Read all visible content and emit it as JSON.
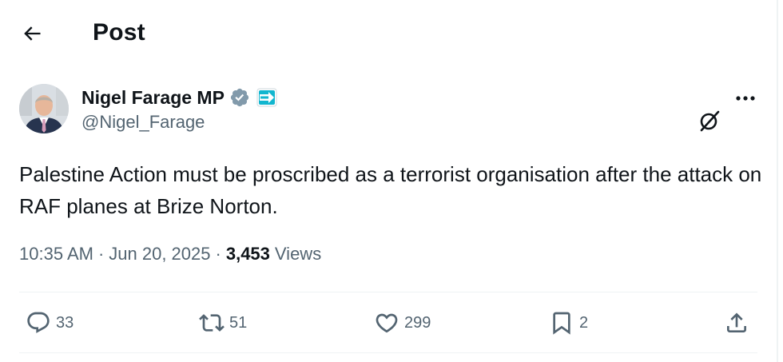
{
  "header": {
    "title": "Post",
    "back_icon": "arrow-left-icon"
  },
  "author": {
    "display_name": "Nigel Farage MP",
    "handle": "@Nigel_Farage",
    "verified_icon": "verified-badge-icon",
    "affiliate_badge": "reform-uk-badge-icon",
    "avatar_icon": "profile-avatar"
  },
  "post": {
    "text": "Palestine Action must be proscribed as a terrorist organisation after the attack on RAF planes at Brize Norton.",
    "time": "10:35 AM",
    "date": "Jun 20, 2025",
    "separator": "·",
    "views_count": "3,453",
    "views_label": "Views"
  },
  "actions": {
    "replies": "33",
    "reposts": "51",
    "likes": "299",
    "bookmarks": "2"
  },
  "icons": {
    "grok": "grok-icon",
    "more": "more-dots-icon",
    "reply": "reply-icon",
    "repost": "repost-icon",
    "like": "heart-icon",
    "bookmark": "bookmark-icon",
    "share": "share-icon"
  },
  "colors": {
    "text_primary": "#0f1419",
    "text_secondary": "#536471",
    "verified": "#829aab",
    "divider": "#eff3f4",
    "badge": "#12b6cf"
  }
}
